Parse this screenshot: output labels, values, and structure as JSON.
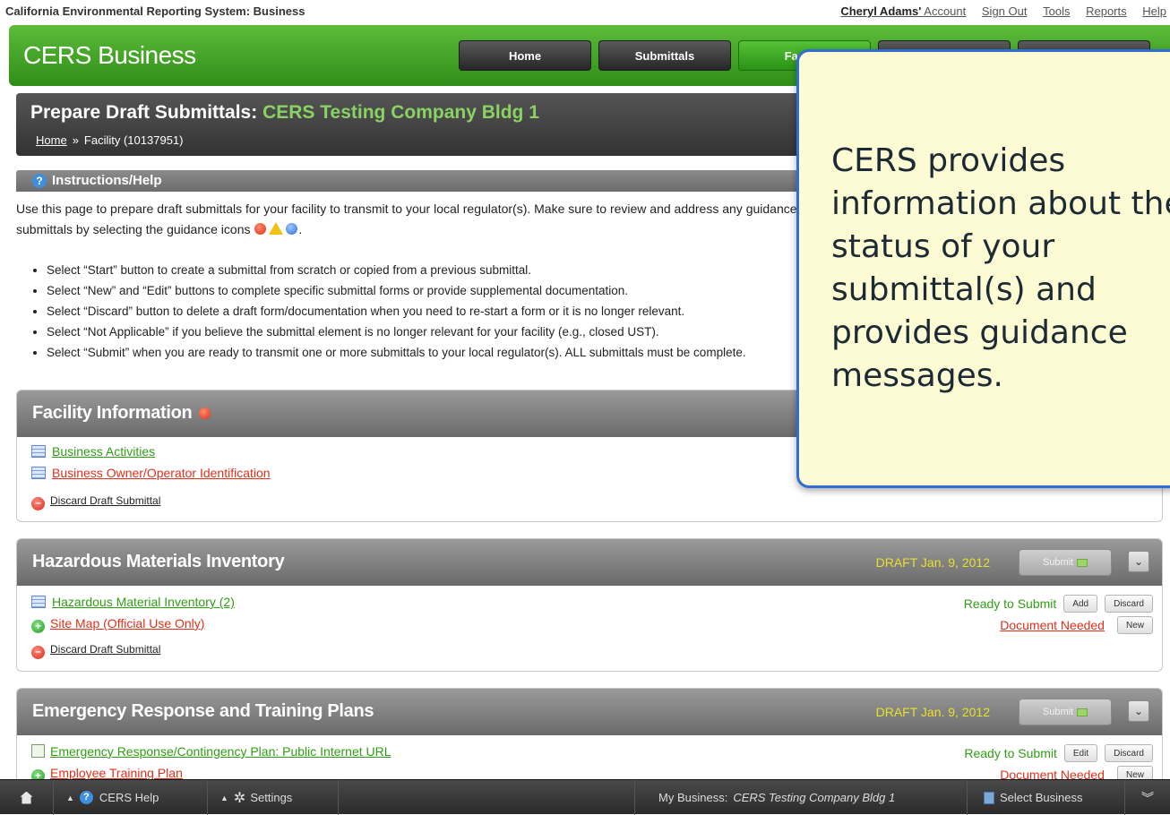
{
  "system_title": "California Environmental Reporting System: Business",
  "util_links": {
    "account_name": "Cheryl Adams'",
    "account_label": "Account",
    "sign_out": "Sign Out",
    "tools": "Tools",
    "reports": "Reports",
    "help": "Help"
  },
  "brand": "CERS Business",
  "nav": [
    "Home",
    "Submittals",
    "Facility",
    "",
    ""
  ],
  "page": {
    "title_prefix": "Prepare Draft Submittals:",
    "facility": "CERS Testing Company Bldg 1",
    "crumb_home": "Home",
    "crumb_sep": "»",
    "crumb_current": "Facility (10137951)"
  },
  "instructions": {
    "heading": "Instructions/Help",
    "intro_1": "Use this page to prepare draft submittals for your facility to transmit to your local regulator(s). Make sure to review and address any guidance messages on the",
    "intro_2": "submittals by selecting the guidance icons",
    "intro_end": ".",
    "bullets": [
      "Select “Start” button to create a submittal from scratch or copied from a previous submittal.",
      "Select “New” and “Edit” buttons to complete specific submittal forms or provide supplemental documentation.",
      "Select “Discard” button to delete a draft form/documentation when you need to re-start a form or it is no longer relevant.",
      "Select “Not Applicable” if you believe the submittal element is no longer relevant for your facility (e.g., closed UST).",
      "Select “Submit” when you are ready to transmit one or more submittals to your local regulator(s). ALL submittals must be complete."
    ]
  },
  "sections": {
    "facility": {
      "title": "Facility Information",
      "rows": {
        "r1": "Business Activities",
        "r2": "Business Owner/Operator Identification",
        "r3": "Discard Draft Submittal"
      }
    },
    "hmi": {
      "title": "Hazardous Materials Inventory",
      "draft": "DRAFT Jan. 9, 2012",
      "submit": "Submit",
      "rows": {
        "r1": "Hazardous Material Inventory (2)",
        "r1_status": "Ready to Submit",
        "r1_btn1": "Add",
        "r1_btn2": "Discard",
        "r2": "Site Map (Official Use Only)",
        "r2_status": "Document Needed",
        "r2_btn1": "New",
        "r3": "Discard Draft Submittal"
      }
    },
    "ertp": {
      "title": "Emergency Response and Training Plans",
      "draft": "DRAFT Jan. 9, 2012",
      "submit": "Submit",
      "rows": {
        "r1": "Emergency Response/Contingency Plan: Public Internet URL",
        "r1_status": "Ready to Submit",
        "r1_btn1": "Edit",
        "r1_btn2": "Discard",
        "r2": "Employee Training Plan",
        "r2_status": "Document Needed",
        "r2_btn1": "New"
      }
    }
  },
  "callout": "CERS provides information about the status of your submittal(s) and provides guidance messages.",
  "bottom_bar": {
    "help": "CERS Help",
    "settings": "Settings",
    "my_business_label": "My Business:",
    "my_business_name": "CERS Testing Company Bldg 1",
    "select_business": "Select Business"
  },
  "colors": {
    "header_green": "#3fa022",
    "link_green": "#2f9e12",
    "status_red": "#e0301c",
    "draft_yellow": "#e8e02a",
    "callout_border": "#2f6fd0",
    "callout_bg": "#fdfbd4"
  },
  "icons": [
    "question-icon",
    "form-list-icon",
    "add-icon",
    "remove-icon",
    "home-icon",
    "gear-icon",
    "building-icon",
    "chevron-down-icon"
  ]
}
